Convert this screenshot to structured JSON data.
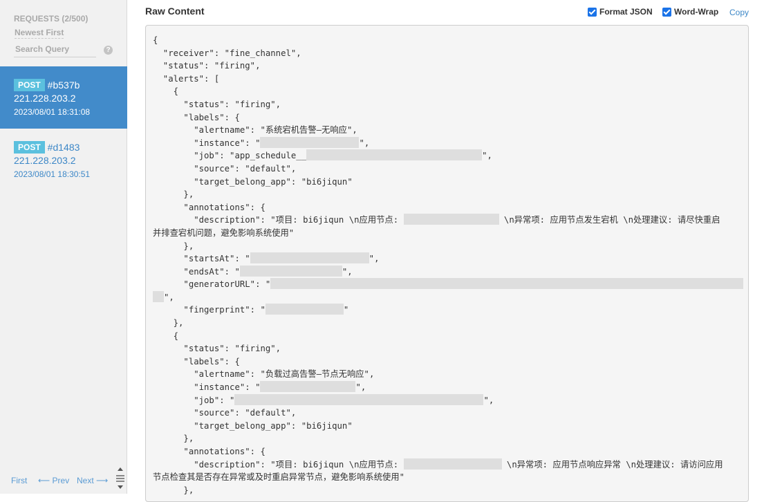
{
  "sidebar": {
    "requests_title": "REQUESTS (2/500)",
    "sort_label": "Newest First",
    "search_placeholder": "Search Query",
    "help_icon": "?",
    "requests": [
      {
        "method": "POST",
        "id": "#b537b",
        "ip": "221.228.203.2",
        "time": "2023/08/01 18:31:08",
        "active": true
      },
      {
        "method": "POST",
        "id": "#d1483",
        "ip": "221.228.203.2",
        "time": "2023/08/01 18:30:51",
        "active": false
      }
    ],
    "pager": {
      "first": "First",
      "prev": "⟵ Prev",
      "next": "Next ⟶"
    }
  },
  "main": {
    "title": "Raw Content",
    "format_json_label": "Format JSON",
    "format_json_checked": true,
    "word_wrap_label": "Word-Wrap",
    "word_wrap_checked": true,
    "copy_label": "Copy",
    "lines": [
      "{",
      "  \"receiver\": \"fine_channel\",",
      "  \"status\": \"firing\",",
      "  \"alerts\": [",
      "    {",
      "      \"status\": \"firing\",",
      "      \"labels\": {",
      "        \"alertname\": \"系统宕机告警—无响应\",",
      "        \"instance\": \"",
      "        \"job\": \"app_schedule__",
      "        \"source\": \"default\",",
      "        \"target_belong_app\": \"bi6jiqun\"",
      "      },",
      "      \"annotations\": {",
      "        \"description\": \"项目: bi6jiqun \\n应用节点:",
      "\\n异常项: 应用节点发生宕机 \\n处理建议: 请尽快重启",
      "并排查宕机问题，避免影响系统使用\"",
      "      },",
      "      \"startsAt\": \"",
      "      \"endsAt\": \"",
      "      \"generatorURL\": \"",
      "\",",
      "      \"fingerprint\": \"",
      "    },",
      "    {",
      "      \"status\": \"firing\",",
      "      \"labels\": {",
      "        \"alertname\": \"负载过高告警—节点无响应\",",
      "        \"instance\": \"",
      "        \"job\": \"",
      "        \"source\": \"default\",",
      "        \"target_belong_app\": \"bi6jiqun\"",
      "      },",
      "      \"annotations\": {",
      "        \"description\": \"项目: bi6jiqun \\n应用节点:",
      "\\n异常项: 应用节点响应异常 \\n处理建议: 请访问应用",
      "节点检查其是否存在异常或及时重启异常节点，避免影响系统使用\"",
      "      },"
    ],
    "closers": [
      "\",",
      "\",",
      "\",",
      "\",",
      "\",",
      "\"",
      "\",",
      "\",",
      "\","
    ]
  }
}
